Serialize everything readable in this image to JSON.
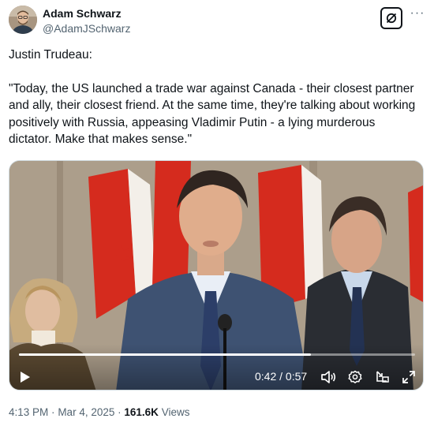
{
  "author": {
    "display_name": "Adam Schwarz",
    "handle": "@AdamJSchwarz"
  },
  "header_icons": {
    "grok": "grok-icon",
    "more": "more-icon",
    "more_glyph": "···"
  },
  "tweet": {
    "line1": "Justin Trudeau:",
    "quote": "\"Today, the US launched a trade war against Canada - their closest partner and ally, their closest friend. At the same time, they're talking about working positively with Russia, appeasing Vladimir Putin - a lying murderous dictator. Make that makes sense.\""
  },
  "video": {
    "current_time": "0:42",
    "separator": "/",
    "duration": "0:57",
    "time_display": "0:42 / 0:57",
    "progress_fraction": 0.737,
    "icons": [
      "play-icon",
      "volume-icon",
      "settings-icon",
      "pip-icon",
      "fullscreen-icon"
    ]
  },
  "meta": {
    "time": "4:13 PM",
    "dot": "·",
    "date": "Mar 4, 2025",
    "views_count": "161.6K",
    "views_label": "Views"
  },
  "colors": {
    "text": "#0f1419",
    "secondary": "#536471",
    "flag_red": "#d52b1e",
    "border": "#cfd9de"
  }
}
